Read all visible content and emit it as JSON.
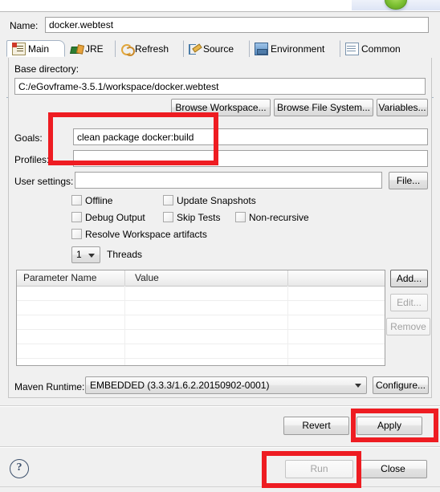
{
  "dialog": {
    "name_label": "Name:",
    "name_value": "docker.webtest"
  },
  "tabs": [
    {
      "label": "Main",
      "icon": "main-config-icon",
      "active": true
    },
    {
      "label": "JRE",
      "icon": "jre-icon",
      "active": false
    },
    {
      "label": "Refresh",
      "icon": "refresh-icon",
      "active": false
    },
    {
      "label": "Source",
      "icon": "source-icon",
      "active": false
    },
    {
      "label": "Environment",
      "icon": "environment-icon",
      "active": false
    },
    {
      "label": "Common",
      "icon": "common-icon",
      "active": false
    }
  ],
  "main": {
    "base_directory_label": "Base directory:",
    "base_directory_value": "C:/eGovframe-3.5.1/workspace/docker.webtest",
    "browse_workspace_label": "Browse Workspace...",
    "browse_file_system_label": "Browse File System...",
    "variables_label": "Variables...",
    "goals_label": "Goals:",
    "goals_value": "clean package docker:build",
    "profiles_label": "Profiles:",
    "profiles_value": "",
    "user_settings_label": "User settings:",
    "user_settings_value": "",
    "file_button_label": "File...",
    "checkboxes": [
      {
        "label": "Offline",
        "checked": false
      },
      {
        "label": "Update Snapshots",
        "checked": false
      },
      {
        "label": "Debug Output",
        "checked": false
      },
      {
        "label": "Skip Tests",
        "checked": false
      },
      {
        "label": "Non-recursive",
        "checked": false
      },
      {
        "label": "Resolve Workspace artifacts",
        "checked": false
      }
    ],
    "threads_value": "1",
    "threads_label": "Threads",
    "table": {
      "columns": [
        "Parameter Name",
        "Value",
        ""
      ],
      "rows": []
    },
    "table_buttons": [
      {
        "label": "Add...",
        "enabled": true
      },
      {
        "label": "Edit...",
        "enabled": false
      },
      {
        "label": "Remove",
        "enabled": false
      }
    ],
    "maven_runtime_label": "Maven Runtime:",
    "maven_runtime_value": "EMBEDDED (3.3.3/1.6.2.20150902-0001)",
    "configure_label": "Configure..."
  },
  "footer": {
    "revert_label": "Revert",
    "apply_label": "Apply",
    "run_label": "Run",
    "close_label": "Close",
    "help_icon": "?"
  },
  "annotations": {
    "highlight_color": "#ee1c22",
    "boxes": [
      "goals-field-highlight",
      "apply-button-highlight",
      "run-button-highlight"
    ]
  }
}
